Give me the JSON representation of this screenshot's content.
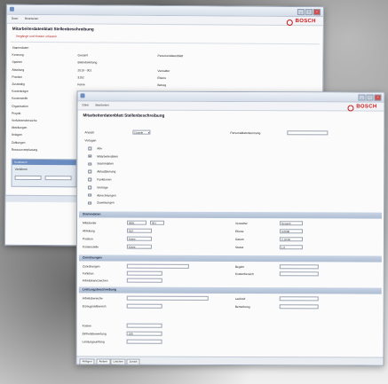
{
  "back_window": {
    "toolbar": {
      "item1": "Datei",
      "item2": "Bearbeiten",
      "brand": "BOSCH"
    },
    "heading": "Mitarbeiterdatenblatt Stellenbeschreibung",
    "subline": "Vorgänge und Kosten erfassen",
    "rows": [
      {
        "label": "Stammdaten",
        "v1": "",
        "v2": "",
        "v3": ""
      },
      {
        "label": "Kennung",
        "v1": "Gesamt",
        "v2": "Personendatenblatt",
        "v3": ""
      },
      {
        "label": "Sparten",
        "v1": "Betriebsleitung",
        "v2": "",
        "v3": ""
      },
      {
        "label": "Abteilung",
        "v1": "2019 - 001",
        "v2": "Verwalter",
        "v3": ""
      },
      {
        "label": "Position",
        "v1": "3152",
        "v2": "Ebene",
        "v3": ""
      },
      {
        "label": "Zuständig",
        "v1": "Keine",
        "v2": "Betrag",
        "v3": ""
      },
      {
        "label": "Kostenträger",
        "v1": "",
        "v2": "Datum",
        "v3": "2.10.06"
      },
      {
        "label": "Kostenstelle",
        "v1": "",
        "v2": "",
        "v3": ""
      },
      {
        "label": "Organisation",
        "v1": "",
        "v2": "",
        "v3": ""
      },
      {
        "label": "Projekt",
        "v1": "",
        "v2": "",
        "v3": ""
      },
      {
        "label": "Verfahrensbereiche",
        "v1": "",
        "v2": "",
        "v3": ""
      },
      {
        "label": "Abteilungen",
        "v1": "",
        "v2": "",
        "v3": ""
      },
      {
        "label": "Anlagen",
        "v1": "",
        "v2": "",
        "v3": ""
      },
      {
        "label": "Zahlungen",
        "v1": "",
        "v2": "",
        "v3": ""
      },
      {
        "label": "Ressourcenplanung",
        "v1": "",
        "v2": "",
        "v3": ""
      }
    ],
    "side_panel_title": "Funktionen",
    "side_panel_item": "Verfahren"
  },
  "front_window": {
    "toolbar": {
      "item1": "Datei",
      "item2": "Bearbeiten",
      "brand": "BOSCH"
    },
    "heading": "Mitarbeiterdatenblatt Stellenbeschreibung",
    "top": {
      "ansicht_label": "Ansicht",
      "ansicht_value": "Einzeln",
      "personaldatenkennung_label": "Personaldatenkennung"
    },
    "filter_title": "Vorlagen",
    "filters": [
      {
        "label": "Alle",
        "checked": false
      },
      {
        "label": "Mitarbeiterdaten",
        "checked": true
      },
      {
        "label": "Stammdaten",
        "checked": false
      },
      {
        "label": "Ablaufplanung",
        "checked": false
      },
      {
        "label": "Funktionen",
        "checked": false
      },
      {
        "label": "Verträge",
        "checked": false
      },
      {
        "label": "Abrechnungen",
        "checked": false
      },
      {
        "label": "Zuweisungen",
        "checked": false
      }
    ],
    "section1": "Stammdaten",
    "left_fields": [
      {
        "label": "Mitarbeiter",
        "v1": "0001",
        "v2": "001"
      },
      {
        "label": "Abteilung",
        "v1": "012",
        "v2": ""
      },
      {
        "label": "Position",
        "v1": "Keine",
        "v2": ""
      },
      {
        "label": "Kostenstelle",
        "v1": "Keine",
        "v2": ""
      }
    ],
    "right_fields": [
      {
        "label": "Verwalter",
        "v": "Gesamt"
      },
      {
        "label": "Ebene",
        "v": "0.0000"
      },
      {
        "label": "Datum",
        "v": "2.10.06"
      },
      {
        "label": "Status",
        "v": "1.0"
      }
    ],
    "section2": "Zuordnungen",
    "sec2_left": [
      {
        "label": "Zuordnungen",
        "v": ""
      },
      {
        "label": "Funktion",
        "v": ""
      },
      {
        "label": "Arbeitskennzeichen",
        "v": ""
      }
    ],
    "sec2_right": [
      {
        "label": "Beginn",
        "v": ""
      },
      {
        "label": "Kostenbereich",
        "v": ""
      }
    ],
    "section3": "Leistungsbeschreibung",
    "sec3_left": [
      {
        "label": "Arbeitsbereiche",
        "v": ""
      },
      {
        "label": "Erzeugnis/Bereich",
        "v": ""
      }
    ],
    "sec3_right": [
      {
        "label": "Laufzeit",
        "v": ""
      },
      {
        "label": "Bemerkung",
        "v": ""
      }
    ],
    "bottom_fields": [
      {
        "label": "Kosten",
        "v": ""
      },
      {
        "label": "Einheitsbewertung",
        "v": "100"
      },
      {
        "label": "Leistungsumfang",
        "v": ""
      }
    ],
    "status_buttons": [
      "Anlegen",
      "Ändern",
      "Löschen",
      "Zurück"
    ]
  }
}
